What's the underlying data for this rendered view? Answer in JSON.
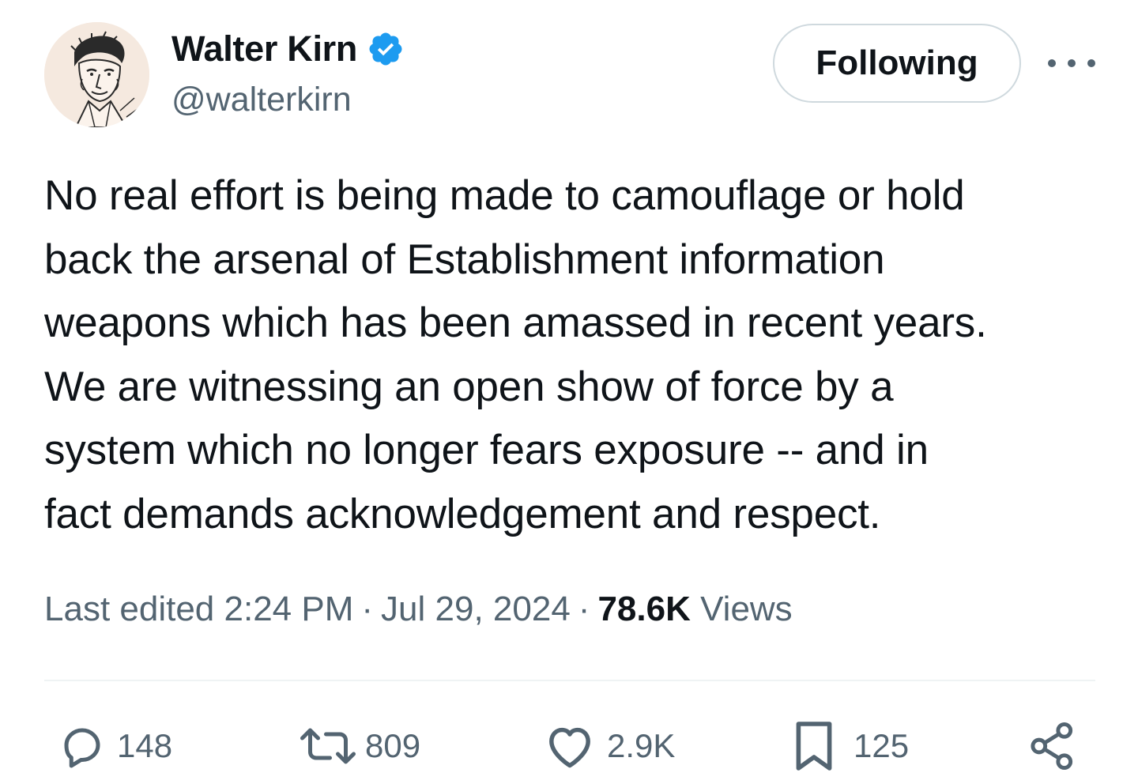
{
  "author": {
    "display_name": "Walter Kirn",
    "handle": "@walterkirn",
    "verified_icon": "verified-badge-icon",
    "avatar_icon": "portrait-sketch-avatar"
  },
  "header": {
    "follow_label": "Following",
    "more_icon": "more-dots-icon"
  },
  "tweet": {
    "text": "No real effort is being made to camouflage or hold\nback the arsenal of Establishment information\nweapons which has been amassed in recent years.\nWe are witnessing an open show of force by a\nsystem which no longer fears exposure -- and in\nfact demands acknowledgement and respect.",
    "edited_label": "Last edited",
    "time": "2:24 PM",
    "separator": "·",
    "date": "Jul 29, 2024",
    "views_count": "78.6K",
    "views_label": "Views"
  },
  "actions": {
    "replies": {
      "icon": "reply-icon",
      "count": "148"
    },
    "reposts": {
      "icon": "repost-icon",
      "count": "809"
    },
    "likes": {
      "icon": "heart-icon",
      "count": "2.9K"
    },
    "bookmarks": {
      "icon": "bookmark-icon",
      "count": "125"
    },
    "share": {
      "icon": "share-icon"
    }
  },
  "colors": {
    "text_primary": "#0f1419",
    "text_secondary": "#536471",
    "verified_blue": "#1d9bf0",
    "border": "#cfd9de",
    "divider": "#eff3f4"
  }
}
